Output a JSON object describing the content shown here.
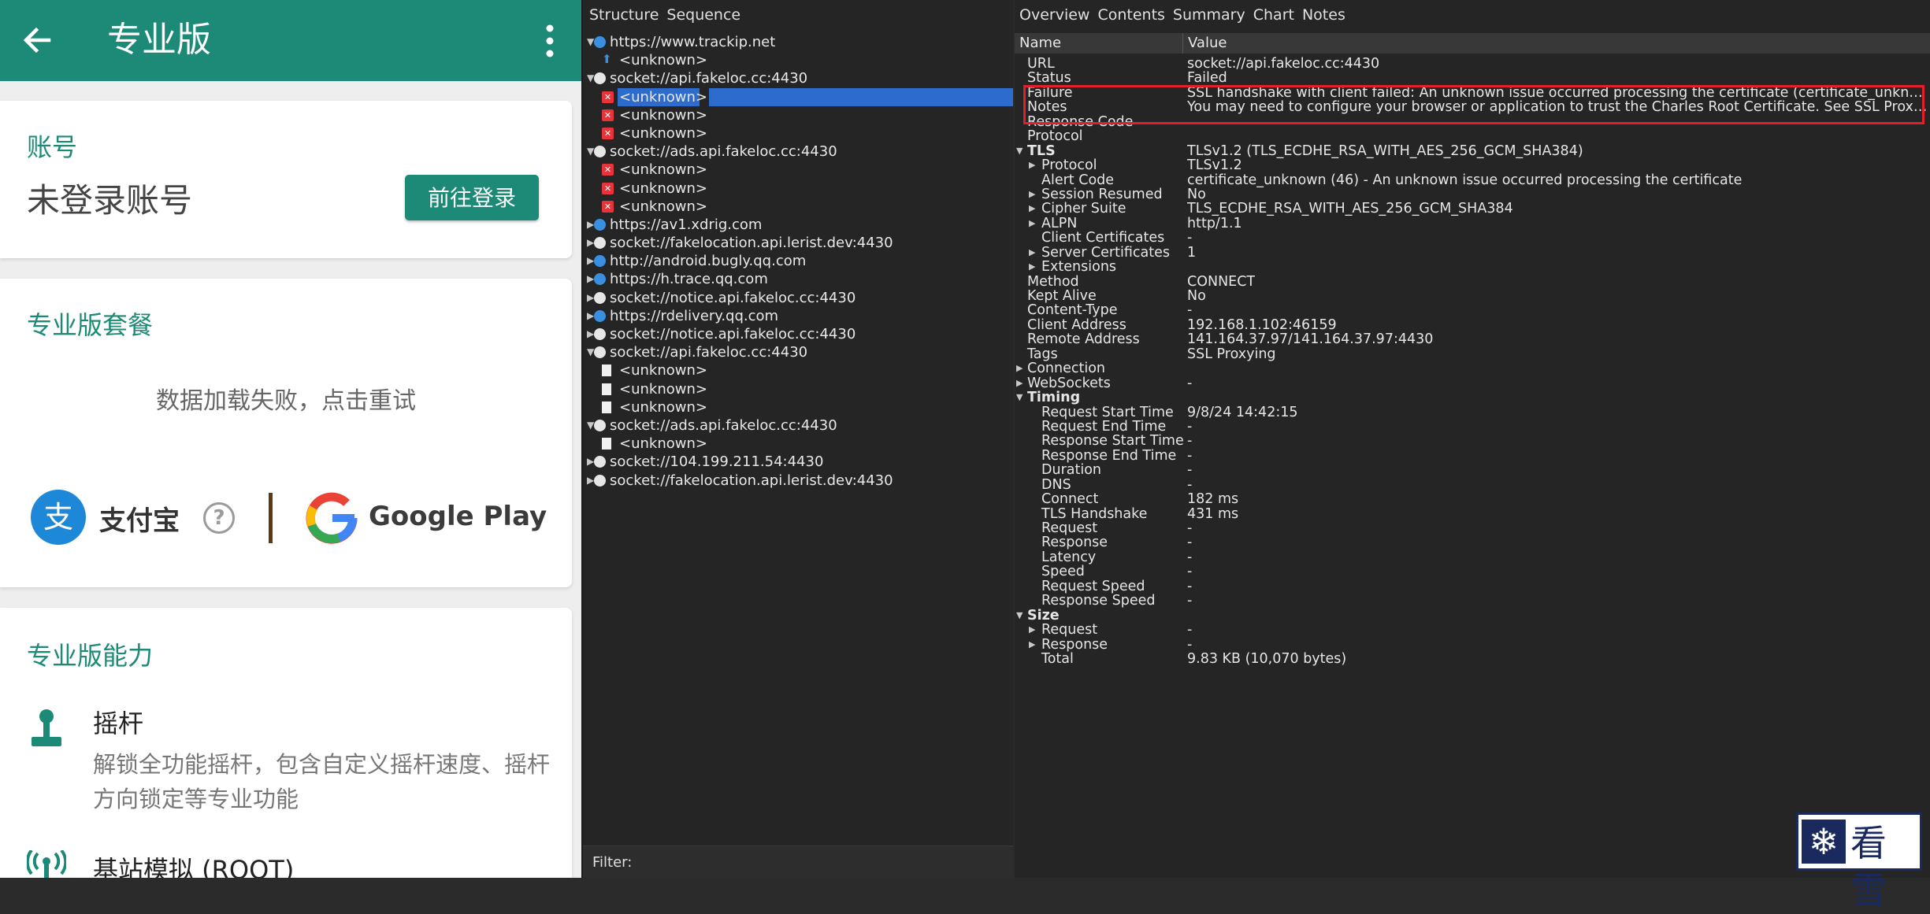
{
  "phone": {
    "title": "专业版",
    "account": {
      "title": "账号",
      "status": "未登录账号",
      "login_button": "前往登录"
    },
    "plan": {
      "title": "专业版套餐",
      "load_error": "数据加载失败，点击重试",
      "alipay": "支付宝",
      "google_play": "Google Play"
    },
    "features": {
      "title": "专业版能力",
      "items": [
        {
          "title": "摇杆",
          "desc": "解锁全功能摇杆，包含自定义摇杆速度、摇杆方向锁定等专业功能"
        },
        {
          "title": "基站模拟 (ROOT)"
        }
      ]
    }
  },
  "charles": {
    "left_tabs": [
      "Structure",
      "Sequence"
    ],
    "tree": [
      {
        "label": "https://www.trackip.net",
        "icon": "globe",
        "level": 0,
        "arrow": "▼"
      },
      {
        "label": "<unknown>",
        "icon": "up-arrow",
        "level": 1
      },
      {
        "label": "socket://api.fakeloc.cc:4430",
        "icon": "socket",
        "level": 0,
        "arrow": "▼"
      },
      {
        "label": "<unknown>",
        "icon": "error",
        "level": 1,
        "selected": true
      },
      {
        "label": "<unknown>",
        "icon": "error",
        "level": 1
      },
      {
        "label": "<unknown>",
        "icon": "error",
        "level": 1
      },
      {
        "label": "socket://ads.api.fakeloc.cc:4430",
        "icon": "socket",
        "level": 0,
        "arrow": "▼"
      },
      {
        "label": "<unknown>",
        "icon": "error",
        "level": 1
      },
      {
        "label": "<unknown>",
        "icon": "error",
        "level": 1
      },
      {
        "label": "<unknown>",
        "icon": "error",
        "level": 1
      },
      {
        "label": "https://av1.xdrig.com",
        "icon": "globe",
        "level": 0,
        "arrow": "▶"
      },
      {
        "label": "socket://fakelocation.api.lerist.dev:4430",
        "icon": "socket",
        "level": 0,
        "arrow": "▶"
      },
      {
        "label": "http://android.bugly.qq.com",
        "icon": "globe",
        "level": 0,
        "arrow": "▶"
      },
      {
        "label": "https://h.trace.qq.com",
        "icon": "globe",
        "level": 0,
        "arrow": "▶"
      },
      {
        "label": "socket://notice.api.fakeloc.cc:4430",
        "icon": "socket",
        "level": 0,
        "arrow": "▶"
      },
      {
        "label": "https://rdelivery.qq.com",
        "icon": "globe",
        "level": 0,
        "arrow": "▶"
      },
      {
        "label": "socket://notice.api.fakeloc.cc:4430",
        "icon": "socket",
        "level": 0,
        "arrow": "▶"
      },
      {
        "label": "socket://api.fakeloc.cc:4430",
        "icon": "socket",
        "level": 0,
        "arrow": "▼"
      },
      {
        "label": "<unknown>",
        "icon": "doc",
        "level": 1
      },
      {
        "label": "<unknown>",
        "icon": "doc",
        "level": 1
      },
      {
        "label": "<unknown>",
        "icon": "doc",
        "level": 1
      },
      {
        "label": "socket://ads.api.fakeloc.cc:4430",
        "icon": "socket",
        "level": 0,
        "arrow": "▼"
      },
      {
        "label": "<unknown>",
        "icon": "doc",
        "level": 1
      },
      {
        "label": "socket://104.199.211.54:4430",
        "icon": "socket",
        "level": 0,
        "arrow": "▶"
      },
      {
        "label": "socket://fakelocation.api.lerist.dev:4430",
        "icon": "socket",
        "level": 0,
        "arrow": "▶"
      }
    ],
    "filter_label": "Filter:",
    "right_tabs": [
      "Overview",
      "Contents",
      "Summary",
      "Chart",
      "Notes"
    ],
    "columns": {
      "name": "Name",
      "value": "Value"
    },
    "props": [
      {
        "name": "URL",
        "value": "socket://api.fakeloc.cc:4430",
        "level": 1
      },
      {
        "name": "Status",
        "value": "Failed",
        "level": 1
      },
      {
        "name": "Failure",
        "value": "SSL handshake with client failed: An unknown issue occurred processing the certificate (certificate_unknown)",
        "level": 1
      },
      {
        "name": "Notes",
        "value": "You may need to configure your browser or application to trust the Charles Root Certificate. See SSL Proxying in the Help menu.",
        "level": 1
      },
      {
        "name": "Response Code",
        "value": "",
        "level": 1
      },
      {
        "name": "Protocol",
        "value": "",
        "level": 1
      },
      {
        "name": "TLS",
        "value": "TLSv1.2 (TLS_ECDHE_RSA_WITH_AES_256_GCM_SHA384)",
        "level": 0,
        "arrow": "▼",
        "section": true
      },
      {
        "name": "Protocol",
        "value": "TLSv1.2",
        "level": 2,
        "arrow": "▶"
      },
      {
        "name": "Alert Code",
        "value": "certificate_unknown (46) - An unknown issue occurred processing the certificate",
        "level": 2
      },
      {
        "name": "Session Resumed",
        "value": "No",
        "level": 2,
        "arrow": "▶"
      },
      {
        "name": "Cipher Suite",
        "value": "TLS_ECDHE_RSA_WITH_AES_256_GCM_SHA384",
        "level": 2,
        "arrow": "▶"
      },
      {
        "name": "ALPN",
        "value": "http/1.1",
        "level": 2,
        "arrow": "▶"
      },
      {
        "name": "Client Certificates",
        "value": "-",
        "level": 2
      },
      {
        "name": "Server Certificates",
        "value": "1",
        "level": 2,
        "arrow": "▶"
      },
      {
        "name": "Extensions",
        "value": "",
        "level": 2,
        "arrow": "▶"
      },
      {
        "name": "Method",
        "value": "CONNECT",
        "level": 1
      },
      {
        "name": "Kept Alive",
        "value": "No",
        "level": 1
      },
      {
        "name": "Content-Type",
        "value": "-",
        "level": 1
      },
      {
        "name": "Client Address",
        "value": "192.168.1.102:46159",
        "level": 1
      },
      {
        "name": "Remote Address",
        "value": "141.164.37.97/141.164.37.97:4430",
        "level": 1
      },
      {
        "name": "Tags",
        "value": "SSL Proxying",
        "level": 1
      },
      {
        "name": "Connection",
        "value": "",
        "level": 0,
        "arrow": "▶"
      },
      {
        "name": "WebSockets",
        "value": "-",
        "level": 0,
        "arrow": "▶"
      },
      {
        "name": "Timing",
        "value": "",
        "level": 0,
        "arrow": "▼",
        "section": true
      },
      {
        "name": "Request Start Time",
        "value": "9/8/24 14:42:15",
        "level": 2
      },
      {
        "name": "Request End Time",
        "value": "-",
        "level": 2
      },
      {
        "name": "Response Start Time",
        "value": "-",
        "level": 2
      },
      {
        "name": "Response End Time",
        "value": "-",
        "level": 2
      },
      {
        "name": "Duration",
        "value": "-",
        "level": 2
      },
      {
        "name": "DNS",
        "value": "-",
        "level": 2
      },
      {
        "name": "Connect",
        "value": "182 ms",
        "level": 2
      },
      {
        "name": "TLS Handshake",
        "value": "431 ms",
        "level": 2
      },
      {
        "name": "Request",
        "value": "-",
        "level": 2
      },
      {
        "name": "Response",
        "value": "-",
        "level": 2
      },
      {
        "name": "Latency",
        "value": "-",
        "level": 2
      },
      {
        "name": "Speed",
        "value": "-",
        "level": 2
      },
      {
        "name": "Request Speed",
        "value": "-",
        "level": 2
      },
      {
        "name": "Response Speed",
        "value": "-",
        "level": 2
      },
      {
        "name": "Size",
        "value": "",
        "level": 0,
        "arrow": "▼",
        "section": true
      },
      {
        "name": "Request",
        "value": "-",
        "level": 2,
        "arrow": "▶"
      },
      {
        "name": "Response",
        "value": "-",
        "level": 2,
        "arrow": "▶"
      },
      {
        "name": "Total",
        "value": "9.83 KB (10,070 bytes)",
        "level": 2
      }
    ]
  },
  "watermark": {
    "text": "看雪"
  },
  "colors": {
    "accent": "#1c8a76",
    "selection": "#2d6ccc",
    "highlight_box": "#e0202a"
  }
}
